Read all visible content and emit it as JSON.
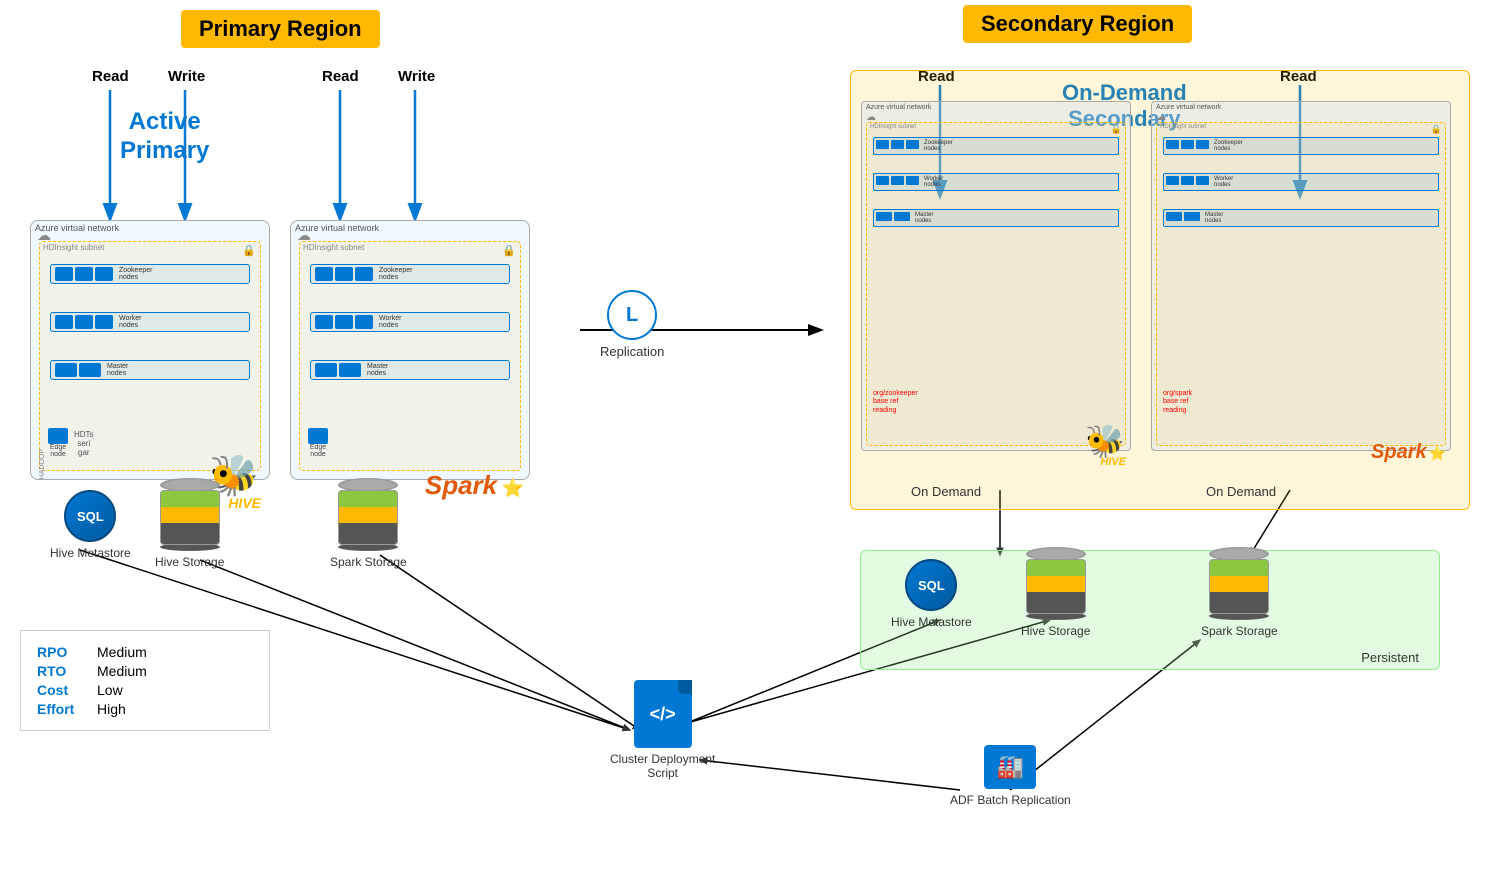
{
  "regions": {
    "primary": {
      "label": "Primary Region",
      "active_label": "Active\nPrimary"
    },
    "secondary": {
      "label": "Secondary Region",
      "secondary_type": "On-Demand\nSecondary"
    }
  },
  "primary_left_cluster": {
    "read_label": "Read",
    "write_label": "Write",
    "vnet_label": "Azure virtual network",
    "hdi_label": "HDInsight subnet",
    "zookeeper": "Zookeeper nodes",
    "worker": "Worker nodes",
    "master": "Master nodes",
    "edge": "Edge node",
    "type": "HIVE"
  },
  "primary_right_cluster": {
    "read_label": "Read",
    "write_label": "Write",
    "vnet_label": "Azure virtual network",
    "hdi_label": "HDInsight subnet",
    "zookeeper": "Zookeeper nodes",
    "worker": "Worker nodes",
    "master": "Master nodes",
    "edge": "Edge node",
    "type": "Spark"
  },
  "replication": {
    "label": "Replication",
    "icon": "L"
  },
  "storage_items": [
    {
      "label": "Hive Metastore",
      "type": "sql"
    },
    {
      "label": "Hive Storage",
      "type": "cylinder"
    },
    {
      "label": "Spark Storage",
      "type": "cylinder"
    }
  ],
  "secondary_storage": [
    {
      "label": "Hive Metastore",
      "type": "sql"
    },
    {
      "label": "Hive Storage",
      "type": "cylinder"
    },
    {
      "label": "Spark Storage",
      "type": "cylinder"
    }
  ],
  "persistent_label": "Persistent",
  "on_demand_labels": [
    "On Demand",
    "On Demand"
  ],
  "script": {
    "label": "Cluster Deployment\nScript",
    "icon": "</>"
  },
  "adf": {
    "label": "ADF Batch Replication"
  },
  "metrics": [
    {
      "key": "RPO",
      "value": "Medium"
    },
    {
      "key": "RTO",
      "value": "Medium"
    },
    {
      "key": "Cost",
      "value": "Low"
    },
    {
      "key": "Effort",
      "value": "High"
    }
  ],
  "colors": {
    "primary_yellow": "#FFB900",
    "azure_blue": "#0078D4",
    "accent_blue": "#0078D4"
  }
}
